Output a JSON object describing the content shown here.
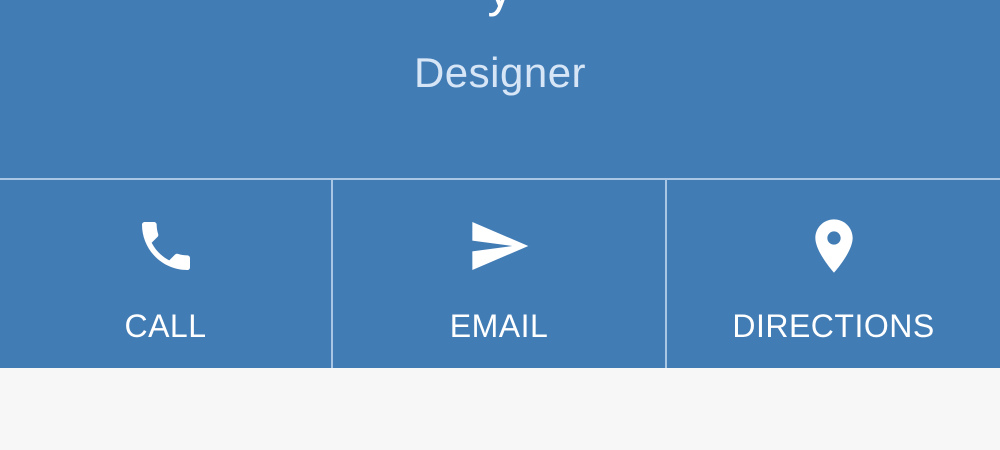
{
  "profile": {
    "name": "y",
    "role": "Designer",
    "background_color": "#427cb5"
  },
  "actions": [
    {
      "label": "CALL",
      "icon": "phone-icon"
    },
    {
      "label": "EMAIL",
      "icon": "send-icon"
    },
    {
      "label": "DIRECTIONS",
      "icon": "location-pin-icon"
    }
  ]
}
